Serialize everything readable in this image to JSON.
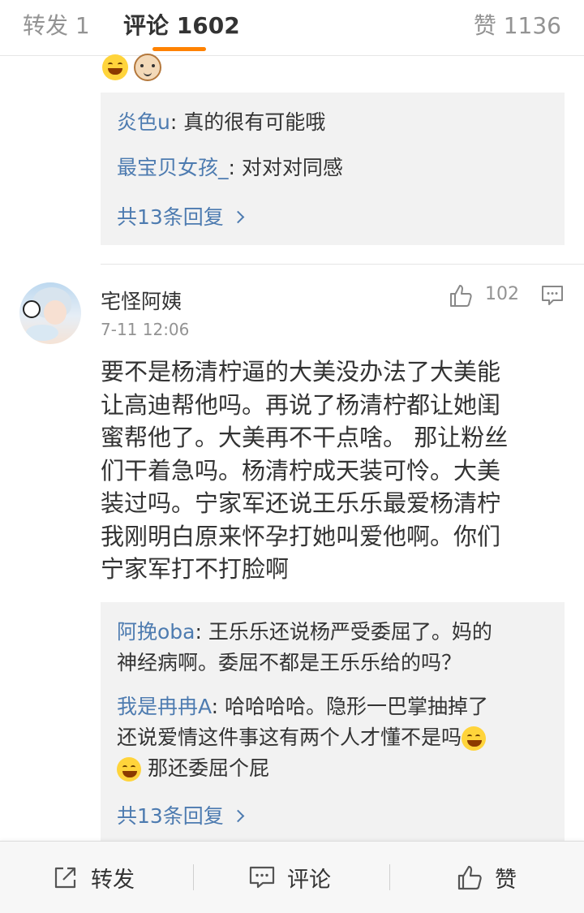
{
  "tabs": {
    "repost": "转发 1",
    "comment": "评论 1602",
    "like": "赞 1136",
    "active_color": "#ff8200"
  },
  "top_replies": {
    "items": [
      {
        "user": "炎色u",
        "text": ": 真的很有可能哦"
      },
      {
        "user": "最宝贝女孩_",
        "text": ": 对对对同感"
      }
    ],
    "more": "共13条回复"
  },
  "comment": {
    "user": "宅怪阿姨",
    "time": "7-11 12:06",
    "likes": "102",
    "text": "要不是杨清柠逼的大美没办法了大美能\n让高迪帮他吗。再说了杨清柠都让她闺\n蜜帮他了。大美再不干点啥。 那让粉丝\n们干着急吗。杨清柠成天装可怜。大美\n装过吗。宁家军还说王乐乐最爱杨清柠\n我刚明白原来怀孕打她叫爱他啊。你们\n宁家军打不打脸啊",
    "replies": [
      {
        "user": "阿挽oba",
        "text": ": 王乐乐还说杨严受委屈了。妈的\n神经病啊。委屈不都是王乐乐给的吗？"
      },
      {
        "user": "我是冉冉A",
        "text1": ": 哈哈哈哈。隐形一巴掌抽掉了\n还说爱情这件事这有两个人才懂不是吗",
        "text2": " 那还委屈个屁"
      }
    ],
    "more": "共13条回复"
  },
  "bottom_bar": {
    "repost": "转发",
    "comment": "评论",
    "like": "赞"
  },
  "colors": {
    "username": "#4d7bb0",
    "secondary_text": "#939393",
    "reply_bg": "#f2f2f2"
  }
}
